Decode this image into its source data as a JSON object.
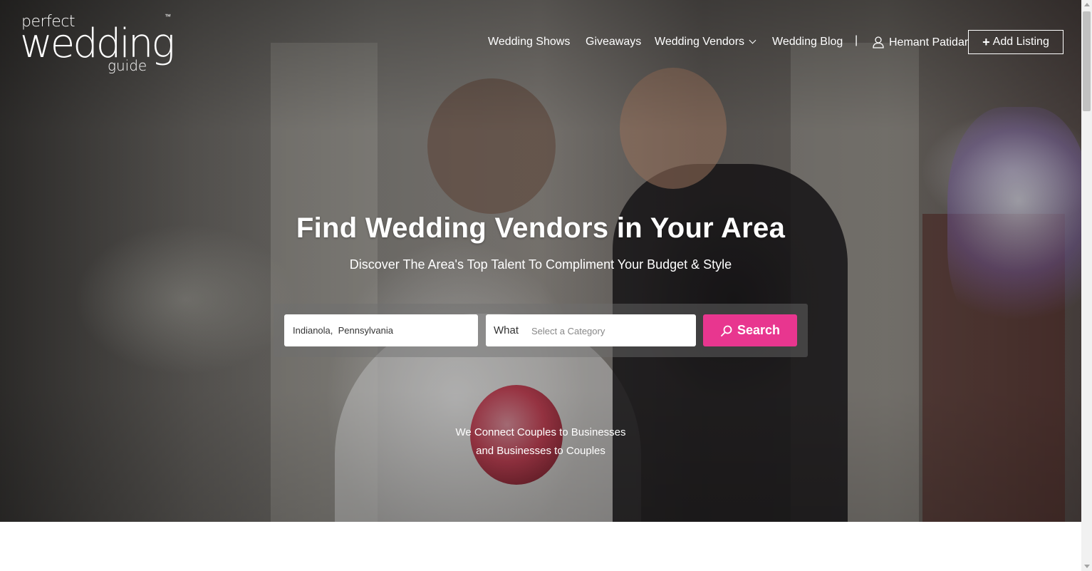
{
  "logo": {
    "line1": "perfect",
    "line2": "wedding",
    "line3": "guide",
    "tm": "™"
  },
  "nav": {
    "items": [
      {
        "label": "Wedding Shows"
      },
      {
        "label": "Giveaways"
      },
      {
        "label": "Wedding Vendors"
      },
      {
        "label": "Wedding Blog"
      }
    ],
    "separator": "|",
    "user_name": "Hemant Patidar",
    "add_listing": "Add Listing"
  },
  "hero": {
    "title": "Find Wedding Vendors in Your Area",
    "subtitle": "Discover The Area's Top Talent To Compliment Your Budget & Style",
    "tagline_line1": "We Connect Couples to Businesses",
    "tagline_line2": "and Businesses to Couples"
  },
  "search": {
    "location_value": "Indianola,  Pennsylvania",
    "what_label": "What",
    "category_placeholder": "Select a Category",
    "button_label": "Search"
  },
  "colors": {
    "accent": "#e8368f"
  }
}
